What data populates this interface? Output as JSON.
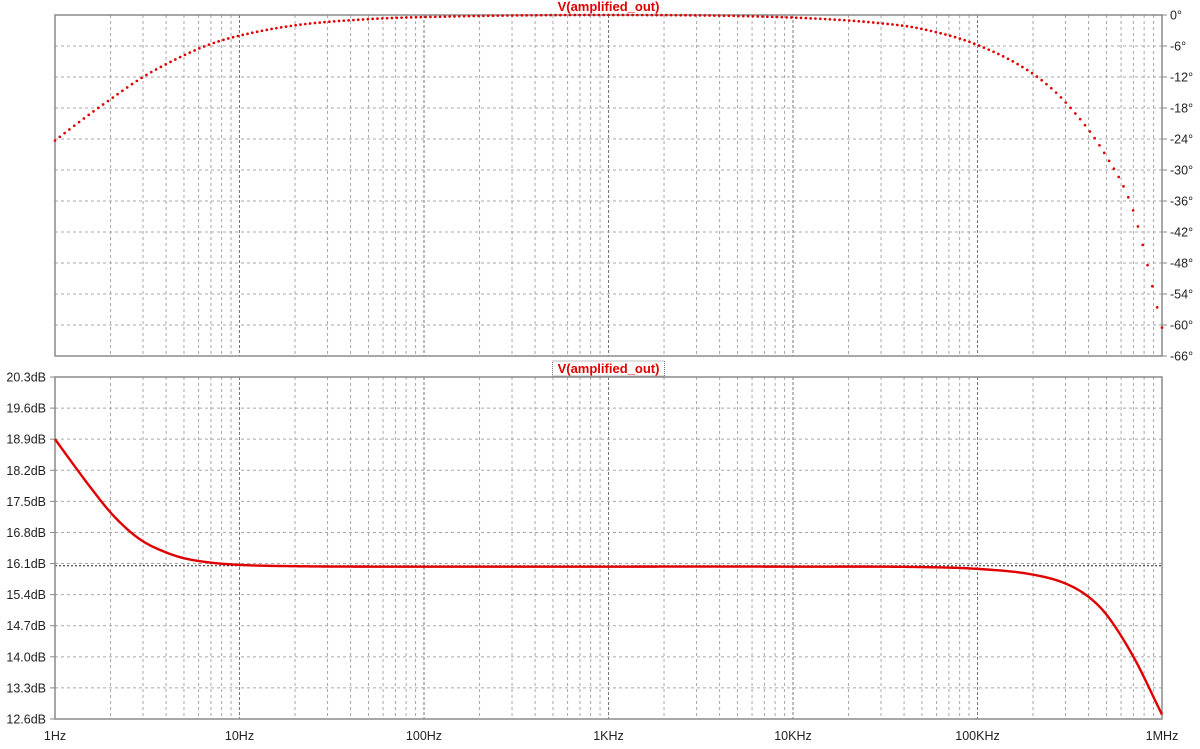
{
  "chart_data": [
    {
      "type": "line",
      "title": "V(amplified_out)",
      "x_scale": "log",
      "xlim": [
        1,
        1000000
      ],
      "ylim": [
        -66,
        0
      ],
      "y_ticks": [
        "0°",
        "-6°",
        "-12°",
        "-18°",
        "-24°",
        "-30°",
        "-36°",
        "-42°",
        "-48°",
        "-54°",
        "-60°",
        "-66°"
      ],
      "y_tick_values": [
        0,
        -6,
        -12,
        -18,
        -24,
        -30,
        -36,
        -42,
        -48,
        -54,
        -60,
        -66
      ],
      "y_axis_side": "right",
      "line_style": "dotted",
      "grid": true,
      "series": [
        {
          "color": "#e00000",
          "x": [
            1,
            1.5,
            2,
            3,
            5,
            7,
            10,
            20,
            50,
            100,
            1000,
            10000,
            30000,
            50000,
            100000,
            200000,
            300000,
            500000,
            700000,
            1000000
          ],
          "values": [
            -24.3,
            -19.5,
            -16.3,
            -12.0,
            -7.8,
            -5.6,
            -4.0,
            -2.0,
            -0.8,
            -0.4,
            0,
            -0.5,
            -1.6,
            -2.7,
            -5.8,
            -11.4,
            -16.9,
            -27.4,
            -38.0,
            -60.5
          ]
        }
      ]
    },
    {
      "type": "line",
      "title": "V(amplified_out)",
      "x_scale": "log",
      "xlim": [
        1,
        1000000
      ],
      "ylim": [
        12.6,
        20.3
      ],
      "y_ticks": [
        "20.3dB",
        "19.6dB",
        "18.9dB",
        "18.2dB",
        "17.5dB",
        "16.8dB",
        "16.1dB",
        "15.4dB",
        "14.7dB",
        "14.0dB",
        "13.3dB",
        "12.6dB"
      ],
      "y_tick_values": [
        20.3,
        19.6,
        18.9,
        18.2,
        17.5,
        16.8,
        16.1,
        15.4,
        14.7,
        14.0,
        13.3,
        12.6
      ],
      "y_axis_side": "left",
      "x_ticks": [
        "1Hz",
        "10Hz",
        "100Hz",
        "1KHz",
        "10KHz",
        "100KHz",
        "1MHz"
      ],
      "x_tick_values": [
        1,
        10,
        100,
        1000,
        10000,
        100000,
        1000000
      ],
      "line_style": "solid",
      "grid": true,
      "cursor_y": 16.05,
      "series": [
        {
          "color": "#e00000",
          "x": [
            1,
            1.3,
            1.6,
            2,
            2.5,
            3,
            4,
            5,
            7,
            10,
            20,
            100,
            10000,
            50000,
            100000,
            200000,
            300000,
            400000,
            500000,
            700000,
            1000000
          ],
          "values": [
            18.9,
            18.25,
            17.75,
            17.25,
            16.85,
            16.6,
            16.35,
            16.22,
            16.12,
            16.07,
            16.04,
            16.03,
            16.03,
            16.02,
            15.98,
            15.85,
            15.65,
            15.35,
            14.95,
            14.0,
            12.7
          ]
        }
      ]
    }
  ]
}
